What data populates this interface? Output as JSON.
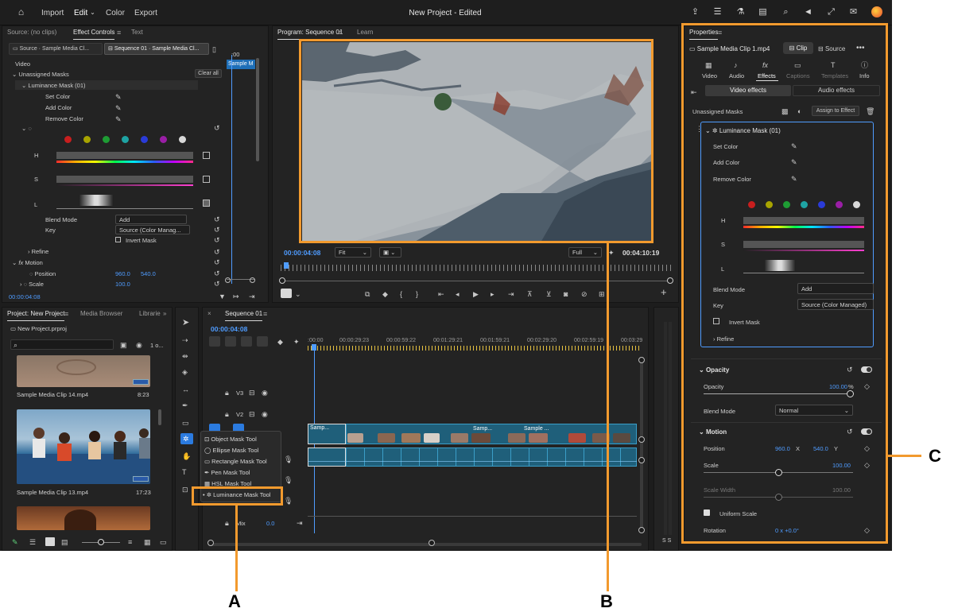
{
  "topbar": {
    "title": "New Project - Edited",
    "menu": [
      "Import",
      "Edit",
      "Color",
      "Export"
    ],
    "active_menu": "Edit"
  },
  "source_panel": {
    "tabs": [
      "Source: (no clips)",
      "Effect Controls",
      "Text"
    ],
    "active_tab": "Effect Controls",
    "subtab_source": "Source · Sample Media Cl...",
    "subtab_sequence": "Sequence 01 · Sample Media Cl...",
    "clip_label": "Sample M",
    "time_marker": ":00",
    "video_label": "Video",
    "unassigned_masks": "Unassigned Masks",
    "clear_all": "Clear all",
    "luminance_mask": "Luminance Mask (01)",
    "set_color": "Set Color",
    "add_color": "Add Color",
    "remove_color": "Remove Color",
    "h_label": "H",
    "s_label": "S",
    "l_label": "L",
    "blend_mode": "Blend Mode",
    "blend_value": "Add",
    "key": "Key",
    "key_value": "Source (Color Manag...",
    "invert_mask": "Invert Mask",
    "refine": "Refine",
    "motion": "Motion",
    "position": "Position",
    "position_x": "960.0",
    "position_y": "540.0",
    "scale": "Scale",
    "scale_value": "100.0",
    "timecode": "00:00:04:08"
  },
  "program_panel": {
    "tabs": [
      "Program: Sequence 01",
      "Learn"
    ],
    "timecode": "00:00:04:08",
    "fit": "Fit",
    "quality": "Full",
    "duration": "00:04:10:19"
  },
  "project_panel": {
    "tabs": [
      "Project: New Project",
      "Media Browser",
      "Librarie"
    ],
    "project_file": "New Project.prproj",
    "count": "1 o...",
    "clips": [
      {
        "name": "Sample Media Clip 14.mp4",
        "duration": "8:23"
      },
      {
        "name": "Sample Media Clip 13.mp4",
        "duration": "17:23"
      }
    ]
  },
  "timeline": {
    "tab": "Sequence 01",
    "timecode": "00:00:04:08",
    "ruler": [
      ":00:00",
      "00:00:29:23",
      "00:00:59:22",
      "00:01:29:21",
      "00:01:59:21",
      "00:02:29:20",
      "00:02:59:19",
      "00:03:29"
    ],
    "tracks": [
      "V3",
      "V2"
    ],
    "mix_label": "Mix",
    "mix_value": "0.0",
    "clip_labels": [
      "Samp...",
      "Samp...",
      "Sample ..."
    ],
    "mask_menu": [
      "Object Mask Tool",
      "Ellipse Mask Tool",
      "Rectangle Mask Tool",
      "Pen Mask Tool",
      "HSL Mask Tool",
      "Luminance Mask Tool"
    ]
  },
  "meter": {
    "label": "S S"
  },
  "properties": {
    "header": "Properties",
    "clip_name": "Sample Media Clip 1.mp4",
    "clip_btn": "Clip",
    "source_btn": "Source",
    "tabs": [
      "Video",
      "Audio",
      "Effects",
      "Captions",
      "Templates",
      "Info"
    ],
    "active_tab": "Effects",
    "video_effects": "Video effects",
    "audio_effects": "Audio effects",
    "unassigned_masks": "Unassigned Masks",
    "assign": "Assign to Effect",
    "luminance_mask": "Luminance Mask (01)",
    "set_color": "Set Color",
    "add_color": "Add Color",
    "remove_color": "Remove Color",
    "h_label": "H",
    "s_label": "S",
    "l_label": "L",
    "blend_mode": "Blend Mode",
    "blend_value": "Add",
    "key": "Key",
    "key_value": "Source (Color Managed)",
    "invert_mask": "Invert Mask",
    "refine": "Refine",
    "opacity_section": "Opacity",
    "opacity": "Opacity",
    "opacity_value": "100.00",
    "opacity_unit": "%",
    "blend_mode2": "Blend Mode",
    "blend_mode2_value": "Normal",
    "motion_section": "Motion",
    "position": "Position",
    "position_x": "960.0",
    "x_label": "X",
    "position_y": "540.0",
    "y_label": "Y",
    "scale": "Scale",
    "scale_value": "100.00",
    "scale_width": "Scale Width",
    "scale_width_value": "100.00",
    "uniform_scale": "Uniform Scale",
    "rotation": "Rotation",
    "rotation_value": "0 x +0.0°"
  },
  "swatches": [
    "#c81e1e",
    "#a8a400",
    "#1e9c34",
    "#1ea3a3",
    "#2a3bd8",
    "#9a1ea6",
    "#d8d8d8"
  ],
  "callouts": {
    "a": "A",
    "b": "B",
    "c": "C"
  }
}
